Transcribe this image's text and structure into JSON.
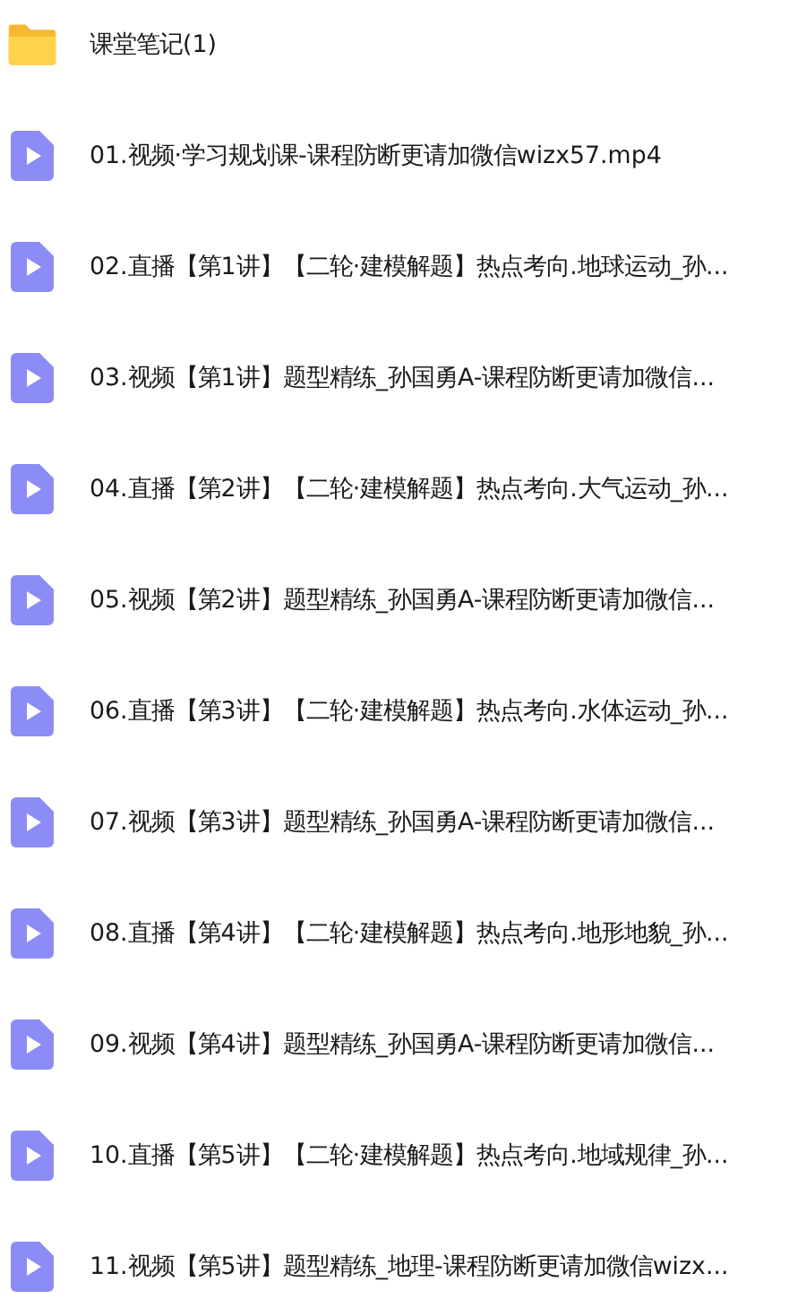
{
  "files": [
    {
      "kind": "folder",
      "name": "课堂笔记(1)"
    },
    {
      "kind": "video",
      "name": "01.视频·学习规划课-课程防断更请加微信wizx57.mp4"
    },
    {
      "kind": "video",
      "name": "02.直播【第1讲】【二轮·建模解题】热点考向.地球运动_孙..."
    },
    {
      "kind": "video",
      "name": "03.视频【第1讲】题型精练_孙国勇A-课程防断更请加微信..."
    },
    {
      "kind": "video",
      "name": "04.直播【第2讲】【二轮·建模解题】热点考向.大气运动_孙..."
    },
    {
      "kind": "video",
      "name": "05.视频【第2讲】题型精练_孙国勇A-课程防断更请加微信..."
    },
    {
      "kind": "video",
      "name": "06.直播【第3讲】【二轮·建模解题】热点考向.水体运动_孙..."
    },
    {
      "kind": "video",
      "name": "07.视频【第3讲】题型精练_孙国勇A-课程防断更请加微信..."
    },
    {
      "kind": "video",
      "name": "08.直播【第4讲】【二轮·建模解题】热点考向.地形地貌_孙..."
    },
    {
      "kind": "video",
      "name": "09.视频【第4讲】题型精练_孙国勇A-课程防断更请加微信..."
    },
    {
      "kind": "video",
      "name": "10.直播【第5讲】【二轮·建模解题】热点考向.地域规律_孙..."
    },
    {
      "kind": "video",
      "name": "11.视频【第5讲】题型精练_地理-课程防断更请加微信wizx..."
    }
  ]
}
